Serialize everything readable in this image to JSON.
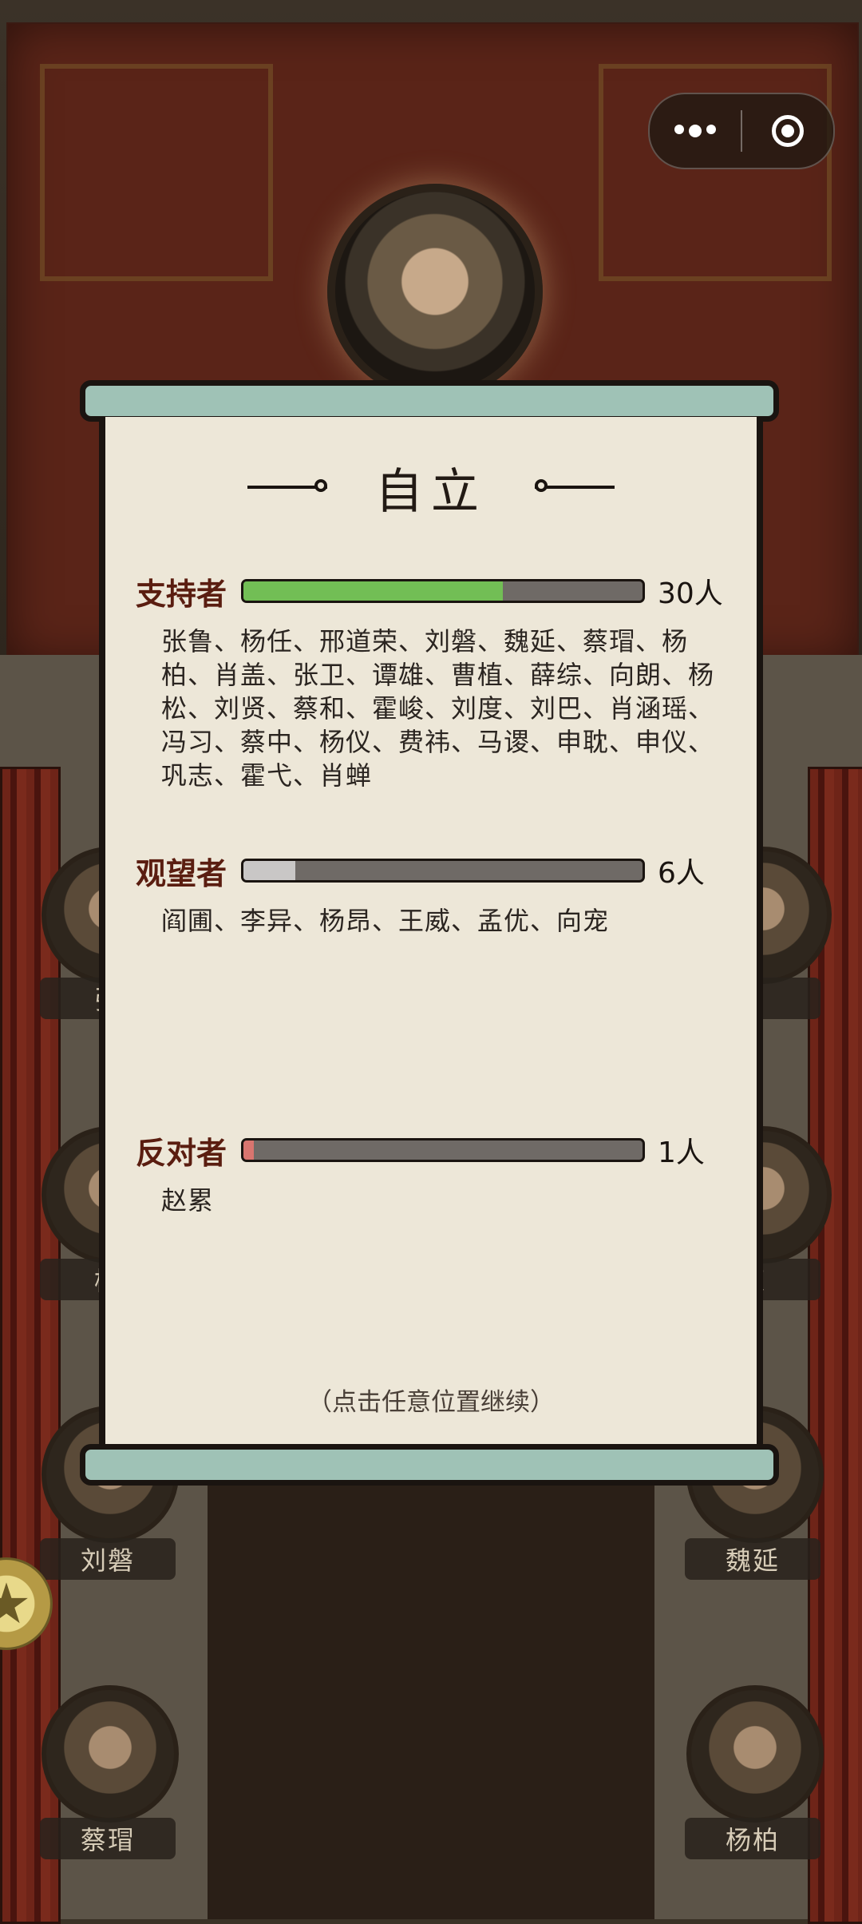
{
  "capsule": {
    "more_icon": "more-dots-icon",
    "close_icon": "target-circle-icon"
  },
  "background_characters": [
    {
      "name": "张",
      "side": "left"
    },
    {
      "name": "",
      "side": "right"
    },
    {
      "name": "杨",
      "side": "left"
    },
    {
      "name": "荣",
      "side": "right"
    },
    {
      "name": "刘磐",
      "side": "left"
    },
    {
      "name": "魏延",
      "side": "right"
    },
    {
      "name": "蔡瑁",
      "side": "left"
    },
    {
      "name": "杨柏",
      "side": "right"
    }
  ],
  "panel": {
    "title": "自立",
    "groups": [
      {
        "label": "支持者",
        "count": "30人",
        "fraction": 0.65,
        "color": "#72be55",
        "names": "张鲁、杨任、邢道荣、刘磐、魏延、蔡瑁、杨柏、肖盖、张卫、谭雄、曹植、薛综、向朗、杨松、刘贤、蔡和、霍峻、刘度、刘巴、肖涵瑶、冯习、蔡中、杨仪、费祎、马谡、申耽、申仪、巩志、霍弋、肖蝉"
      },
      {
        "label": "观望者",
        "count": "6人",
        "fraction": 0.13,
        "color": "#c9c7c6",
        "names": "阎圃、李异、杨昂、王威、孟优、向宠"
      },
      {
        "label": "反对者",
        "count": "1人",
        "fraction": 0.025,
        "color": "#d9756f",
        "names": "赵累"
      }
    ],
    "hint": "（点击任意位置继续）"
  }
}
